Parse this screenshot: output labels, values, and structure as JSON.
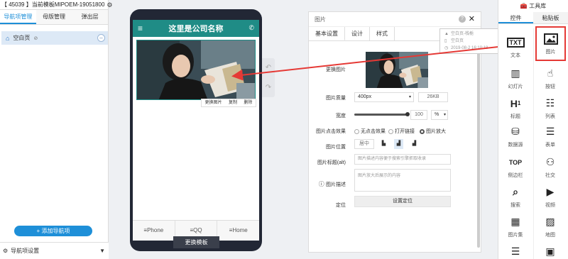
{
  "app": {
    "topbar": "【 45039 】当前模板MIPOEM-19051800",
    "gear_icon": "gear-icon"
  },
  "left_tabs": [
    "导航项管理",
    "母版管理",
    "弹出层"
  ],
  "nav_item": {
    "label": "空白页",
    "circle": "–"
  },
  "add_nav_button": "+ 添加导航项",
  "bottom_bar": {
    "label": "导航项设置",
    "arrow": "▼"
  },
  "phone": {
    "title": "这里是公司名称",
    "image_tools": [
      "更换图片",
      "复制",
      "删除"
    ],
    "footer": [
      "≡Phone",
      "≡QQ",
      "≡Home"
    ],
    "change_template": "更换模板"
  },
  "props": {
    "title": "图片",
    "help": "?",
    "close": "✕",
    "tabs": [
      "基本设置",
      "设计",
      "样式"
    ],
    "labels": {
      "change_image": "更换图片",
      "quality": "图片质量",
      "width": "宽度",
      "click_effect": "图片点击效果",
      "position": "图片位置",
      "alt": "图片标题(alt)",
      "desc": "图片描述",
      "locate": "定位"
    },
    "quality_value": "400px",
    "quality_size": "26KB",
    "width_value": "100",
    "width_unit": "%",
    "width_fraction": 1.0,
    "click_options": [
      "无点击效果",
      "打开链接",
      "图片放大"
    ],
    "click_selected": 2,
    "position_label": "居中",
    "alt_placeholder": "图片描述内容便于搜索引擎抓取收录",
    "desc_placeholder": "图片放大后展示的内容",
    "locate_button": "设置定位"
  },
  "tooltip": {
    "line1": "空白页-栈栀",
    "line2": "空白页",
    "line3": "2019-08-2 16:10:18"
  },
  "toolbox": {
    "title": "工具库",
    "tabs": [
      "控件",
      "粘贴板"
    ],
    "tools": [
      {
        "label": "文本",
        "icon": "text-icon"
      },
      {
        "label": "图片",
        "icon": "image-icon"
      },
      {
        "label": "幻灯片",
        "icon": "slideshow-icon"
      },
      {
        "label": "按钮",
        "icon": "button-icon"
      },
      {
        "label": "标题",
        "icon": "heading-icon"
      },
      {
        "label": "列表",
        "icon": "list-icon"
      },
      {
        "label": "数据源",
        "icon": "database-icon"
      },
      {
        "label": "表单",
        "icon": "form-icon"
      },
      {
        "label": "侧边栏",
        "icon": "sidebar-icon"
      },
      {
        "label": "社交",
        "icon": "social-icon"
      },
      {
        "label": "搜索",
        "icon": "search-icon"
      },
      {
        "label": "视频",
        "icon": "video-icon"
      },
      {
        "label": "图片集",
        "icon": "gallery-icon"
      },
      {
        "label": "地图",
        "icon": "map-icon"
      }
    ]
  },
  "colors": {
    "accent": "#1e8fd8",
    "phone_header": "#1f8c86",
    "highlight_red": "#e53935"
  }
}
